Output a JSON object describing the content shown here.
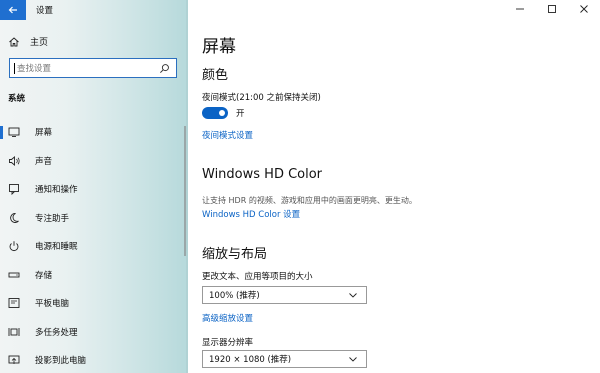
{
  "window": {
    "title": "设置",
    "back_icon": "back-arrow-icon",
    "controls": [
      "minimize-icon",
      "maximize-icon",
      "close-icon"
    ]
  },
  "sidebar": {
    "home_label": "主页",
    "search_placeholder": "查找设置",
    "section_heading": "系统",
    "items": [
      {
        "label": "屏幕",
        "icon": "display-icon",
        "selected": true
      },
      {
        "label": "声音",
        "icon": "speaker-icon"
      },
      {
        "label": "通知和操作",
        "icon": "notification-icon"
      },
      {
        "label": "专注助手",
        "icon": "moon-icon"
      },
      {
        "label": "电源和睡眠",
        "icon": "power-icon"
      },
      {
        "label": "存储",
        "icon": "storage-icon"
      },
      {
        "label": "平板电脑",
        "icon": "tablet-icon"
      },
      {
        "label": "多任务处理",
        "icon": "multitask-icon"
      },
      {
        "label": "投影到此电脑",
        "icon": "project-icon"
      }
    ]
  },
  "main": {
    "page_title": "屏幕",
    "color_heading": "颜色",
    "night_light_label": "夜间模式(21:00 之前保持关闭)",
    "night_light_state": "开",
    "night_light_on": true,
    "night_light_settings_link": "夜间模式设置",
    "hdr_heading": "Windows HD Color",
    "hdr_description": "让支持 HDR 的视频、游戏和应用中的画面更明亮、更生动。",
    "hdr_link": "Windows HD Color 设置",
    "scale_heading": "缩放与布局",
    "scale_label": "更改文本、应用等项目的大小",
    "scale_value": "100% (推荐)",
    "advanced_scaling_link": "高级缩放设置",
    "resolution_label": "显示器分辨率",
    "resolution_value": "1920 × 1080 (推荐)"
  },
  "colors": {
    "accent": "#0b63c5",
    "back_button": "#1f6fd0"
  }
}
